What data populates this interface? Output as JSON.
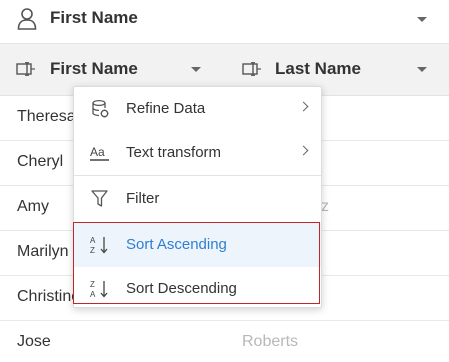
{
  "top_header": {
    "title": "First Name"
  },
  "columns": [
    {
      "label": "First Name"
    },
    {
      "label": "Last Name"
    }
  ],
  "rows": [
    {
      "first": "Theresa",
      "last": ""
    },
    {
      "first": "Cheryl",
      "last": ""
    },
    {
      "first": "Amy",
      "last": "z"
    },
    {
      "first": "Marilyn",
      "last": ""
    },
    {
      "first": "Christine",
      "last": ""
    },
    {
      "first": "Jose",
      "last": "Roberts"
    }
  ],
  "menu": {
    "items": [
      {
        "label": "Refine Data",
        "icon": "database-icon",
        "has_submenu": true
      },
      {
        "label": "Text transform",
        "icon": "text-transform-icon",
        "has_submenu": true
      },
      {
        "label": "Filter",
        "icon": "filter-icon",
        "has_submenu": false
      },
      {
        "label": "Sort Ascending",
        "icon": "sort-ascending-icon",
        "has_submenu": false,
        "selected": true
      },
      {
        "label": "Sort Descending",
        "icon": "sort-descending-icon",
        "has_submenu": false
      }
    ]
  },
  "colors": {
    "accent": "#2f7fd1",
    "highlight_border": "#c0272d",
    "header_bg": "#f2f2f2",
    "muted_text": "#b8b8b8"
  }
}
